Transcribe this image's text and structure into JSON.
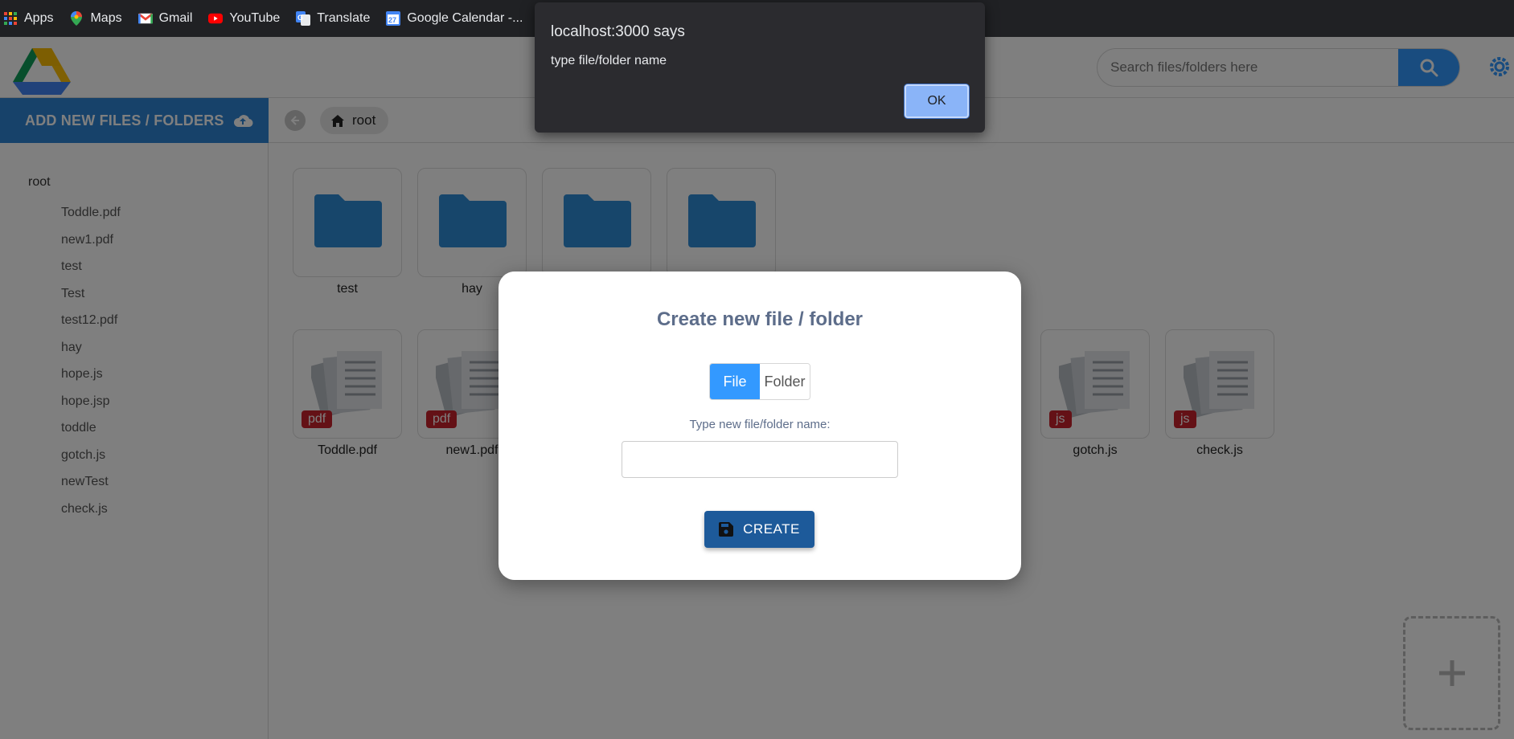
{
  "bookmarks": [
    {
      "label": "Apps",
      "icon": "apps-grid-icon"
    },
    {
      "label": "Maps",
      "icon": "maps-pin-icon"
    },
    {
      "label": "Gmail",
      "icon": "gmail-icon"
    },
    {
      "label": "YouTube",
      "icon": "youtube-icon"
    },
    {
      "label": "Translate",
      "icon": "translate-icon"
    },
    {
      "label": "Google Calendar -...",
      "icon": "calendar-icon",
      "icon_text": "27"
    }
  ],
  "search": {
    "placeholder": "Search files/folders here"
  },
  "toolbar": {
    "add_label": "ADD NEW FILES / FOLDERS",
    "breadcrumb": "root"
  },
  "sidebar": {
    "root": "root",
    "items": [
      "Toddle.pdf",
      "new1.pdf",
      "test",
      "Test",
      "test12.pdf",
      "hay",
      "hope.js",
      "hope.jsp",
      "toddle",
      "gotch.js",
      "newTest",
      "check.js"
    ]
  },
  "folders": [
    "test",
    "hay",
    "",
    ""
  ],
  "files": [
    {
      "name": "Toddle.pdf",
      "ext": "pdf"
    },
    {
      "name": "new1.pdf",
      "ext": "pdf"
    },
    {
      "name": "gotch.js",
      "ext": "js"
    },
    {
      "name": "check.js",
      "ext": "js"
    }
  ],
  "modal": {
    "title": "Create new file / folder",
    "toggle_file": "File",
    "toggle_folder": "Folder",
    "field_label": "Type new file/folder name:",
    "input_value": "",
    "create_label": "CREATE"
  },
  "alert": {
    "title": "localhost:3000 says",
    "message": "type file/folder name",
    "ok_label": "OK"
  },
  "colors": {
    "accent": "#3399ff",
    "add_button": "#2f85d4",
    "create_button": "#1d5a9a",
    "badge": "#c8232c",
    "folder": "#2f8dd6"
  }
}
